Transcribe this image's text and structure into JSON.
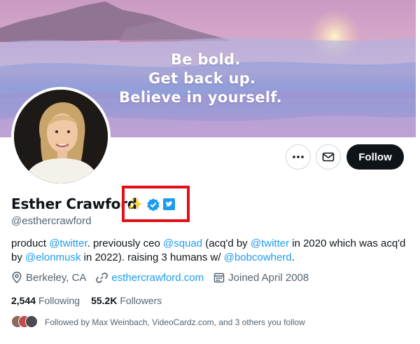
{
  "banner": {
    "quote_line1": "Be bold.",
    "quote_line2": "Get back up.",
    "quote_line3": "Believe in yourself."
  },
  "actions": {
    "more_icon": "more-horizontal-icon",
    "message_icon": "envelope-icon",
    "follow_label": "Follow"
  },
  "profile": {
    "display_name": "Esther Crawford",
    "emoji": "✨",
    "handle": "@esthercrawford",
    "verified_badge": "verified-check-icon",
    "affiliate_badge": "twitter-affiliate-badge",
    "highlight_color": "#e0101a"
  },
  "bio": {
    "p1": "product ",
    "m1": "@twitter",
    "p2": ". previously ceo ",
    "m2": "@squad",
    "p3": " (acq'd by ",
    "m3": "@twitter",
    "p4": " in 2020 which was acq'd by ",
    "m4": "@elonmusk",
    "p5": " in 2022). raising 3 humans w/ ",
    "m5": "@bobcowherd",
    "p6": "."
  },
  "meta": {
    "location": "Berkeley, CA",
    "website": "esthercrawford.com",
    "joined": "Joined April 2008"
  },
  "stats": {
    "following_count": "2,544",
    "following_label": "Following",
    "followers_count": "55.2K",
    "followers_label": "Followers"
  },
  "followed_by": "Followed by Max Weinbach, VideoCardz.com, and 3 others you follow",
  "colors": {
    "accent": "#1d9bf0",
    "text": "#0f1419",
    "muted": "#536471"
  }
}
